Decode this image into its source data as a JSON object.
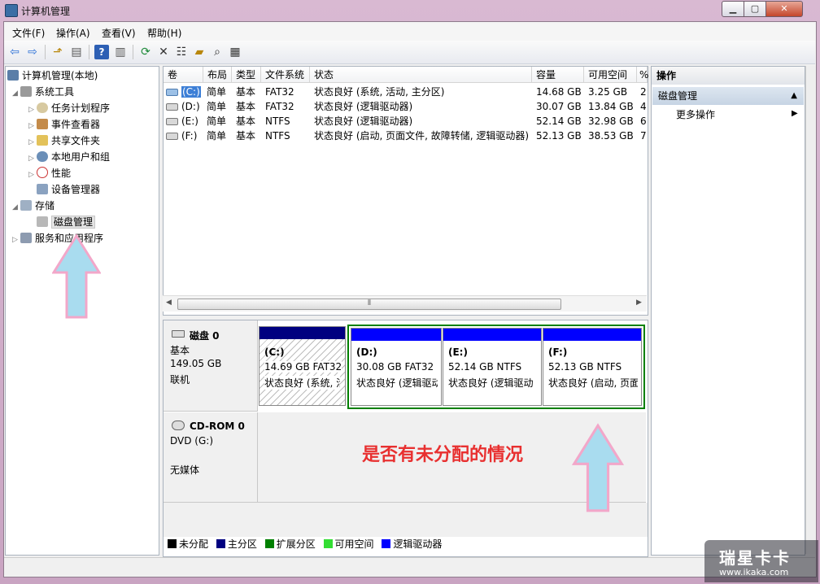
{
  "window": {
    "title": "计算机管理"
  },
  "caption_buttons": {
    "minimize": "▁",
    "maximize": "▢",
    "close": "✕"
  },
  "menu": [
    "文件(F)",
    "操作(A)",
    "查看(V)",
    "帮助(H)"
  ],
  "toolbar_icons": [
    "back-icon",
    "forward-icon",
    "up-icon",
    "show-hide-tree-icon",
    "help-icon",
    "console-icon",
    "refresh-icon",
    "delete-icon",
    "properties-icon",
    "open-icon",
    "search-icon",
    "export-icon"
  ],
  "tree": {
    "root": "计算机管理(本地)",
    "items": [
      {
        "label": "系统工具",
        "level": 1
      },
      {
        "label": "任务计划程序",
        "level": 2
      },
      {
        "label": "事件查看器",
        "level": 2
      },
      {
        "label": "共享文件夹",
        "level": 2
      },
      {
        "label": "本地用户和组",
        "level": 2
      },
      {
        "label": "性能",
        "level": 2
      },
      {
        "label": "设备管理器",
        "level": 2
      },
      {
        "label": "存储",
        "level": 1
      },
      {
        "label": "磁盘管理",
        "level": 2
      },
      {
        "label": "服务和应用程序",
        "level": 1
      }
    ]
  },
  "volumes": {
    "columns": [
      "卷",
      "布局",
      "类型",
      "文件系统",
      "状态",
      "容量",
      "可用空间",
      "%"
    ],
    "rows": [
      [
        "(C:)",
        "简单",
        "基本",
        "FAT32",
        "状态良好 (系统, 活动, 主分区)",
        "14.68 GB",
        "3.25 GB",
        "2"
      ],
      [
        "(D:)",
        "简单",
        "基本",
        "FAT32",
        "状态良好 (逻辑驱动器)",
        "30.07 GB",
        "13.84 GB",
        "4"
      ],
      [
        "(E:)",
        "简单",
        "基本",
        "NTFS",
        "状态良好 (逻辑驱动器)",
        "52.14 GB",
        "32.98 GB",
        "6"
      ],
      [
        "(F:)",
        "简单",
        "基本",
        "NTFS",
        "状态良好 (启动, 页面文件, 故障转储, 逻辑驱动器)",
        "52.13 GB",
        "38.53 GB",
        "7"
      ]
    ]
  },
  "disks": [
    {
      "name": "磁盘 0",
      "type": "基本",
      "size": "149.05 GB",
      "status": "联机",
      "partitions": [
        {
          "name": "(C:)",
          "size": "14.69 GB FAT32",
          "status": "状态良好 (系统, 活"
        },
        {
          "name": "(D:)",
          "size": "30.08 GB FAT32",
          "status": "状态良好 (逻辑驱动"
        },
        {
          "name": "(E:)",
          "size": "52.14 GB NTFS",
          "status": "状态良好 (逻辑驱动"
        },
        {
          "name": "(F:)",
          "size": "52.13 GB NTFS",
          "status": "状态良好 (启动, 页面"
        }
      ]
    },
    {
      "name": "CD-ROM 0",
      "type": "DVD (G:)",
      "status": "无媒体"
    }
  ],
  "legend": [
    {
      "label": "未分配",
      "color": "#000000"
    },
    {
      "label": "主分区",
      "color": "#000080"
    },
    {
      "label": "扩展分区",
      "color": "#008000"
    },
    {
      "label": "可用空间",
      "color": "#33dd33"
    },
    {
      "label": "逻辑驱动器",
      "color": "#0000ff"
    }
  ],
  "actions": {
    "title": "操作",
    "group": "磁盘管理",
    "more": "更多操作"
  },
  "annotation": {
    "text": "是否有未分配的情况"
  },
  "watermark": {
    "brand": "瑞星卡卡",
    "url": "www.ikaka.com"
  },
  "colors": {
    "primary_partition": "#000080",
    "logical_drive": "#0000ff",
    "extended_partition": "#008000",
    "note": "#e83030"
  }
}
